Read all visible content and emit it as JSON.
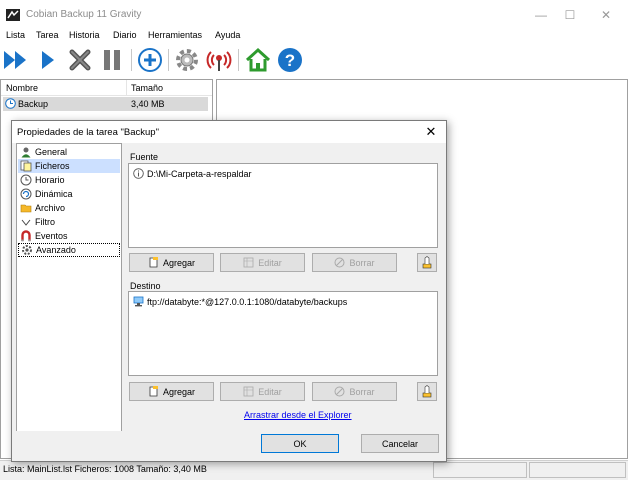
{
  "window": {
    "title": "Cobian Backup 11 Gravity",
    "minimize": "—",
    "maximize": "☐",
    "close": "✕"
  },
  "menu": [
    "Lista",
    "Tarea",
    "Historia",
    "Diario",
    "Herramientas",
    "Ayuda"
  ],
  "toolbar": {
    "icons": [
      "run-all-icon",
      "run-selected-icon",
      "cancel-icon",
      "pause-icon",
      "add-task-icon",
      "settings-icon",
      "antenna-icon",
      "home-icon",
      "help-icon"
    ]
  },
  "task_list": {
    "columns": [
      "Nombre",
      "Tamaño"
    ],
    "rows": [
      {
        "name": "Backup",
        "size": "3,40 MB"
      }
    ]
  },
  "dialog": {
    "title": "Propiedades de la tarea \"Backup\"",
    "close": "✕",
    "nav": [
      {
        "label": "General",
        "icon": "person-icon"
      },
      {
        "label": "Ficheros",
        "icon": "files-icon",
        "selected": true
      },
      {
        "label": "Horario",
        "icon": "clock-icon"
      },
      {
        "label": "Dinámica",
        "icon": "dynamic-icon"
      },
      {
        "label": "Archivo",
        "icon": "folder-icon"
      },
      {
        "label": "Filtro",
        "icon": "filter-icon"
      },
      {
        "label": "Eventos",
        "icon": "magnet-icon"
      },
      {
        "label": "Avanzado",
        "icon": "gear-icon",
        "focused": true
      }
    ],
    "source": {
      "label": "Fuente",
      "items": [
        "D:\\Mi-Carpeta-a-respaldar"
      ],
      "buttons": {
        "add": "Agregar",
        "edit": "Editar",
        "delete": "Borrar"
      }
    },
    "destination": {
      "label": "Destino",
      "items": [
        "ftp://databyte:*@127.0.0.1:1080/databyte/backups"
      ],
      "buttons": {
        "add": "Agregar",
        "edit": "Editar",
        "delete": "Borrar"
      }
    },
    "explorer_link": "Arrastrar desde el Explorer",
    "ok": "OK",
    "cancel": "Cancelar"
  },
  "status_bar": {
    "text": "Lista: MainList.lst   Ficheros: 1008   Tamaño: 3,40 MB"
  },
  "colors": {
    "selection": "#cce0ff",
    "row_highlight": "#d9d9d9",
    "toolbar_blue": "#1a73c8",
    "link": "#0000ee"
  }
}
